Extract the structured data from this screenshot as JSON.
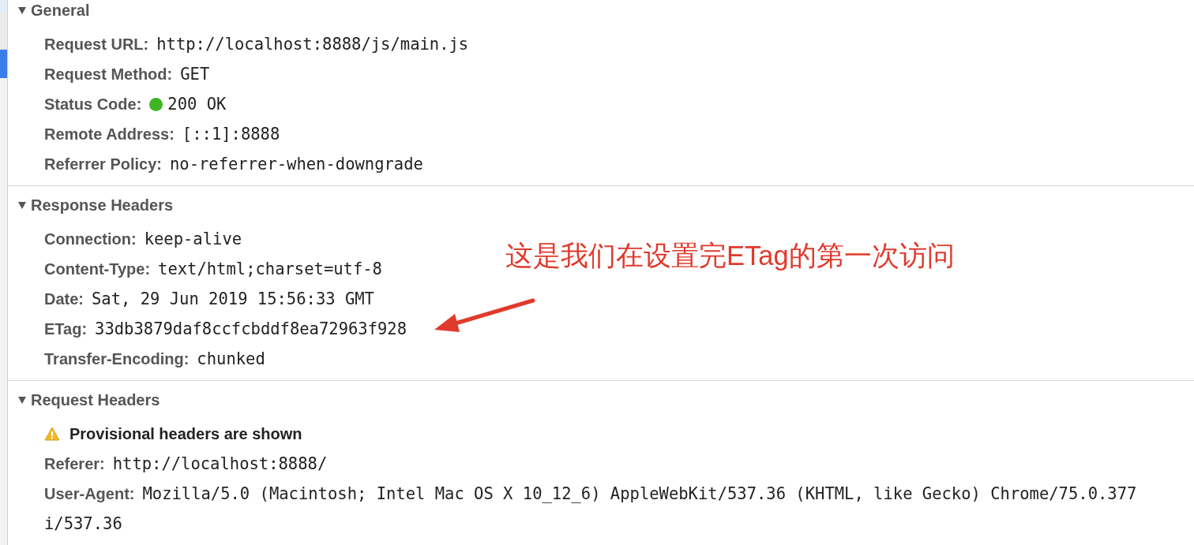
{
  "request_list": {
    "rows": [
      {
        "selected": false,
        "hovered": true
      },
      {
        "selected": false
      },
      {
        "selected": true
      }
    ]
  },
  "sections": [
    {
      "title": "General",
      "expanded": true,
      "rows": [
        {
          "kind": "header",
          "label": "Request URL:",
          "value": "http://localhost:8888/js/main.js"
        },
        {
          "kind": "header",
          "label": "Request Method:",
          "value": "GET"
        },
        {
          "kind": "status",
          "label": "Status Code:",
          "value": "200 OK",
          "color": "#3fb523"
        },
        {
          "kind": "header",
          "label": "Remote Address:",
          "value": "[::1]:8888"
        },
        {
          "kind": "header",
          "label": "Referrer Policy:",
          "value": "no-referrer-when-downgrade"
        }
      ]
    },
    {
      "title": "Response Headers",
      "expanded": true,
      "rows": [
        {
          "kind": "header",
          "label": "Connection:",
          "value": "keep-alive"
        },
        {
          "kind": "header",
          "label": "Content-Type:",
          "value": "text/html;charset=utf-8"
        },
        {
          "kind": "header",
          "label": "Date:",
          "value": "Sat, 29 Jun 2019 15:56:33 GMT"
        },
        {
          "kind": "header",
          "label": "ETag:",
          "value": "33db3879daf8ccfcbddf8ea72963f928"
        },
        {
          "kind": "header",
          "label": "Transfer-Encoding:",
          "value": "chunked"
        }
      ]
    },
    {
      "title": "Request Headers",
      "expanded": true,
      "rows": [
        {
          "kind": "warning",
          "label": "Provisional headers are shown"
        },
        {
          "kind": "header",
          "label": "Referer:",
          "value": "http://localhost:8888/"
        },
        {
          "kind": "header",
          "label": "User-Agent:",
          "value": "Mozilla/5.0 (Macintosh; Intel Mac OS X 10_12_6) AppleWebKit/537.36 (KHTML, like Gecko) Chrome/75.0.377"
        },
        {
          "kind": "continuation",
          "value": "i/537.36"
        }
      ]
    }
  ],
  "annotation": {
    "text": "这是我们在设置完ETag的第一次访问"
  }
}
